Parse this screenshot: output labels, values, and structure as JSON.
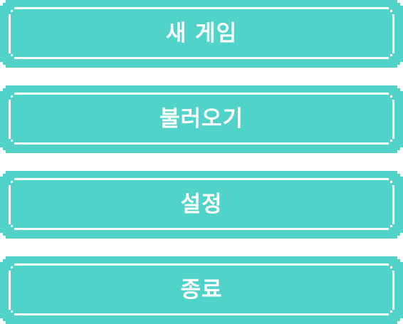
{
  "colors": {
    "button_fill": "#52d3ca",
    "button_inner_line": "#ffffff",
    "label_color": "#ffffff",
    "background": "#ffffff"
  },
  "menu": {
    "new_game_label": "새 게임",
    "load_label": "불러오기",
    "settings_label": "설정",
    "quit_label": "종료"
  }
}
